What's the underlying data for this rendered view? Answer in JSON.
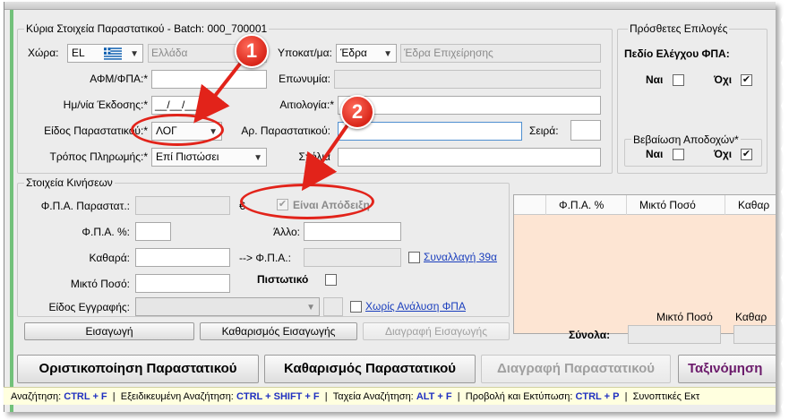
{
  "main_group": {
    "title": "Κύρια Στοιχεία Παραστατικού - Batch: 000_700001",
    "country_label": "Χώρα:",
    "country_code": "EL",
    "country_name": "Ελλάδα",
    "branch_label": "Υποκατ/μα:",
    "branch_value": "Έδρα",
    "branch_name": "Έδρα Επιχείρησης",
    "vat_label": "ΑΦΜ/ΦΠΑ:*",
    "name_label": "Επωνυμία:",
    "date_label": "Ημ/νία Έκδοσης:*",
    "date_value": "__/__/____",
    "reason_label": "Αιτιολογία:*",
    "doctype_label": "Είδος Παραστατικού:*",
    "doctype_value": "ΛΟΓ",
    "docnum_label": "Αρ. Παραστατικού:",
    "series_label": "Σειρά:",
    "payment_label": "Τρόπος Πληρωμής:*",
    "payment_value": "Επί Πιστώσει",
    "comments_label": "Σχόλια"
  },
  "options_group": {
    "title": "Πρόσθετες Επιλογές",
    "vat_check_label": "Πεδίο Ελέγχου ΦΠΑ:",
    "yes_label": "Ναι",
    "no_label": "Όχι",
    "income_title": "Βεβαίωση Αποδοχών*",
    "yes2_label": "Ναι",
    "no2_label": "Όχι"
  },
  "movements_group": {
    "title": "Στοιχεία Κινήσεων",
    "vat_doc_label": "Φ.Π.Α. Παραστατ.:",
    "euro_symbol": "€",
    "receipt_label": "Είναι Απόδειξη",
    "vat_pct_label": "Φ.Π.Α. %:",
    "other_label": "Άλλο:",
    "net_label": "Καθαρά:",
    "vat_arrow_label": "--> Φ.Π.Α.:",
    "transaction_link": "Συναλλαγή 39α",
    "gross_label": "Μικτό Ποσό:",
    "credit_label": "Πιστωτικό",
    "entry_type_label": "Είδος Εγγραφής:",
    "no_vat_analysis_link": "Χωρίς Ανάλυση ΦΠΑ",
    "insert_button": "Εισαγωγή",
    "clear_insert_button": "Καθαρισμός Εισαγωγής",
    "delete_insert_button": "Διαγραφή Εισαγωγής"
  },
  "grid": {
    "columns": [
      "",
      "Φ.Π.Α. %",
      "Μικτό Ποσό",
      "Καθαρ"
    ]
  },
  "totals": {
    "label": "Σύνολα:",
    "gross_header": "Μικτό Ποσό",
    "net_header": "Καθαρ"
  },
  "actions": {
    "finalize": "Οριστικοποίηση Παραστατικού",
    "clear": "Καθαρισμός Παραστατικού",
    "delete": "Διαγραφή Παραστατικού",
    "sort": "Ταξινόμηση"
  },
  "status_bar": [
    {
      "label": "Αναζήτηση:",
      "key": "CTRL + F"
    },
    {
      "label": "Εξειδικευμένη Αναζήτηση:",
      "key": "CTRL + SHIFT + F"
    },
    {
      "label": "Ταχεία Αναζήτηση:",
      "key": "ALT + F"
    },
    {
      "label": "Προβολή και Εκτύπωση:",
      "key": "CTRL + P"
    },
    {
      "label": "Συνοπτικές Εκτ",
      "key": ""
    }
  ],
  "annotations": {
    "badge_1": "1",
    "badge_2": "2",
    "annotation_color": "#e2231a"
  },
  "colors": {
    "window_bg": "#ececec",
    "grid_bg": "#fde5d3",
    "status_bg": "#ffffdf",
    "shortcut_key": "#2030c0",
    "sort_button_text": "#6b1a6b"
  }
}
